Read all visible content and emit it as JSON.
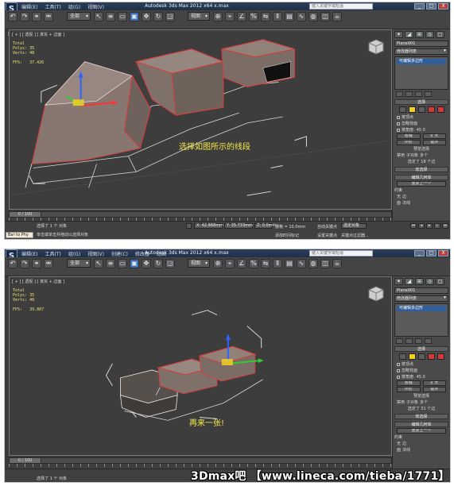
{
  "app": {
    "title": "Autodesk 3ds Max  2012 x64     x.max",
    "logo": "S",
    "search_placeholder": "键入关键字或短语",
    "menu": [
      "编辑(E)",
      "工具(T)",
      "组(G)",
      "视图(V)",
      "创建(C)",
      "修改器",
      "动画",
      "图形编辑器",
      "渲染(R)",
      "自定义(U)",
      "MAXScript(M)",
      "帮助(H)"
    ],
    "selection_filter": "全部",
    "ref_coord": "视图",
    "window_buttons": [
      "_",
      "□",
      "X"
    ]
  },
  "screens": [
    {
      "viewport_label": "[ + ] [ 透视 ] [ 真实 + 边面 ]",
      "stats": "Total\nPolys: 35\nVerts: 48\n\nFPS:   37.426",
      "annotation": "选择如图所示的线段",
      "panel": {
        "object_name": "Plane001",
        "modifier_list": "修改器列表",
        "stack_item": "可编辑多边形",
        "selection_title": "选择",
        "opt_by_vertex": "按顶点",
        "opt_ignore_backface": "忽略背面",
        "opt_by_angle": "按角度:",
        "angle_value": "45.0",
        "shrink": "收缩",
        "grow": "扩大",
        "ring": "环形",
        "loop": "循环",
        "preview_title": "预览选择",
        "preview_off": "禁用",
        "preview_sub": "子对象",
        "preview_multi": "多个",
        "selected_count": "选定了 18 个边",
        "soft_sel": "软选择",
        "edit_geo": "编辑几何体",
        "repeat_last": "重复上一个",
        "constraints": "约束",
        "c_none": "无",
        "c_edge": "边",
        "c_face": "面",
        "c_normal": "法线"
      },
      "time_slider": "0 / 100",
      "status": {
        "maxscript": "Bar to Phy",
        "selected": "选择了 1 个 对象",
        "prompt": "单击或单击并拖动以选择对象",
        "x": "X: 42.868mm",
        "y": "Y: 35.733mm",
        "z": "Z: 0.0mm",
        "grid": "栅格 = 10.0mm",
        "autokey": "自动关键点",
        "sel_set": "选定对象",
        "setkey": "设置关键点",
        "keyfilter": "关键点过滤器...",
        "add_tag": "添加时间标记"
      }
    },
    {
      "viewport_label": "[ + ] [ 透视 ] [ 真实 + 边面 ]",
      "stats": "Total\nPolys: 35\nVerts: 48\n\nFPS:   39.807",
      "annotation": "再来一张!",
      "panel": {
        "object_name": "Plane001",
        "modifier_list": "修改器列表",
        "stack_item": "可编辑多边形",
        "selection_title": "选择",
        "opt_by_vertex": "按顶点",
        "opt_ignore_backface": "忽略背面",
        "opt_by_angle": "按角度:",
        "angle_value": "45.0",
        "shrink": "收缩",
        "grow": "扩大",
        "ring": "环形",
        "loop": "循环",
        "preview_title": "预览选择",
        "preview_off": "禁用",
        "preview_sub": "子对象",
        "preview_multi": "多个",
        "selected_count": "选定了 31 个边",
        "soft_sel": "软选择",
        "edit_geo": "编辑几何体",
        "repeat_last": "重复上一个",
        "constraints": "约束",
        "c_none": "无",
        "c_edge": "边",
        "c_face": "面",
        "c_normal": "法线"
      },
      "time_slider": "0 / 100",
      "status": {
        "selected": "选择了 1 个 对象"
      }
    }
  ],
  "watermark": "3Dmax吧 【www.lineca.com/tieba/1771】",
  "colors": {
    "selected_edge": "#d93b3b",
    "annotation": "#f5e94a",
    "stats": "#e9e27a",
    "stack_selected": "#2f5e9a"
  }
}
